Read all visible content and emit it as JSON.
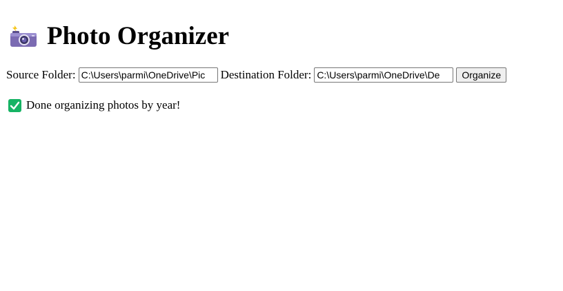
{
  "header": {
    "icon": "camera-with-flash-icon",
    "title": "Photo Organizer"
  },
  "form": {
    "source_label": "Source Folder:",
    "source_value": "C:\\Users\\parmi\\OneDrive\\Pic",
    "destination_label": "Destination Folder:",
    "destination_value": "C:\\Users\\parmi\\OneDrive\\De",
    "organize_label": "Organize"
  },
  "status": {
    "icon": "check-mark-icon",
    "message": "Done organizing photos by year!"
  },
  "colors": {
    "check_green": "#16b364",
    "camera_body": "#7b6bb2",
    "flash_yellow": "#f5c518"
  }
}
